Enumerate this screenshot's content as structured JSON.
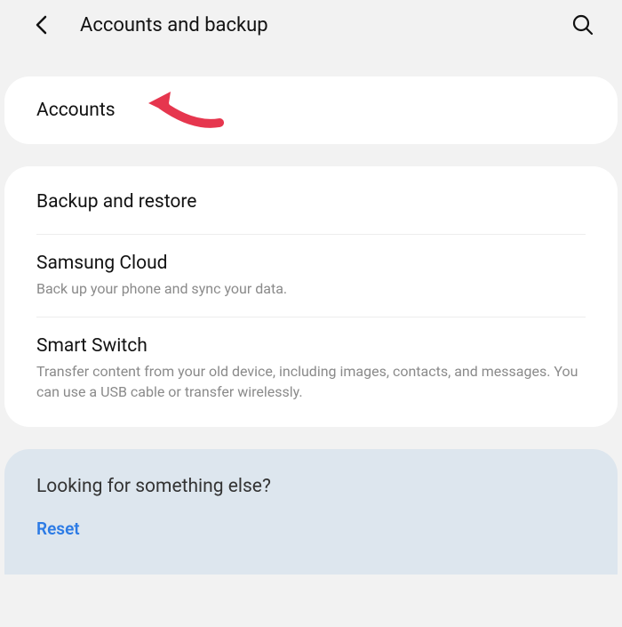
{
  "header": {
    "title": "Accounts and backup"
  },
  "card1": {
    "accounts": {
      "title": "Accounts"
    }
  },
  "card2": {
    "backup_restore": {
      "title": "Backup and restore"
    },
    "samsung_cloud": {
      "title": "Samsung Cloud",
      "subtitle": "Back up your phone and sync your data."
    },
    "smart_switch": {
      "title": "Smart Switch",
      "subtitle": "Transfer content from your old device, including images, contacts, and messages. You can use a USB cable or transfer wirelessly."
    }
  },
  "suggestion": {
    "title": "Looking for something else?",
    "link": "Reset"
  }
}
